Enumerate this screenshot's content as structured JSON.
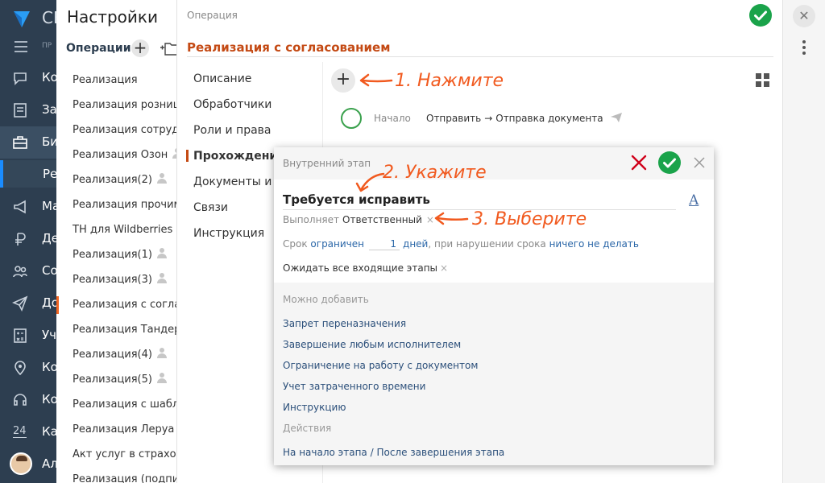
{
  "app": {
    "brand": "СБ",
    "menu_text": "ПР",
    "nav": [
      {
        "label": "Ко",
        "icon": "chat-icon"
      },
      {
        "label": "За",
        "icon": "tasks-icon"
      },
      {
        "label": "Би",
        "icon": "briefcase-icon"
      },
      {
        "label": "Ма",
        "icon": "megaphone-icon"
      },
      {
        "label": "Де",
        "icon": "money-icon"
      },
      {
        "label": "Со",
        "icon": "people-icon"
      },
      {
        "label": "До",
        "icon": "send-icon"
      },
      {
        "label": "Уч",
        "icon": "calculator-icon"
      },
      {
        "label": "Ко",
        "icon": "location-icon"
      },
      {
        "label": "Ко",
        "icon": "headset-icon"
      },
      {
        "label": "Ка",
        "icon": "calendar-icon"
      },
      {
        "label": "Ал",
        "icon": "avatar"
      }
    ],
    "nav_sub": "Ре",
    "calendar_day": "24"
  },
  "settings": {
    "title": "Настройки",
    "operations_label": "Операции",
    "operations": [
      {
        "label": "Реализация",
        "user": false
      },
      {
        "label": "Реализация розницы",
        "user": false
      },
      {
        "label": "Реализация сотрудникам",
        "user": false
      },
      {
        "label": "Реализация Озон",
        "user": true
      },
      {
        "label": "Реализация(2)",
        "user": true
      },
      {
        "label": "Реализация прочим покупателям",
        "user": false
      },
      {
        "label": "ТН для Wildberries",
        "user": false
      },
      {
        "label": "Реализация(1)",
        "user": true
      },
      {
        "label": "Реализация(3)",
        "user": true
      },
      {
        "label": "Реализация с согласованием",
        "user": false,
        "selected": true
      },
      {
        "label": "Реализация Тандер",
        "user": false
      },
      {
        "label": "Реализация(4)",
        "user": true
      },
      {
        "label": "Реализация(5)",
        "user": true
      },
      {
        "label": "Реализация с шаблоном",
        "user": false
      },
      {
        "label": "Реализация Леруа Мерлен",
        "user": false
      },
      {
        "label": "Акт услуг в страховую",
        "user": false
      },
      {
        "label": "Реализация (подписание)",
        "user": false
      }
    ]
  },
  "operation": {
    "kind": "Операция",
    "title": "Реализация с согласованием",
    "tabs": [
      "Описание",
      "Обработчики",
      "Роли и права",
      "Прохождение",
      "Документы и файлы",
      "Связи",
      "Инструкция"
    ],
    "active_tab": "Прохождение",
    "flow": {
      "start": "Начало",
      "action": "Отправить",
      "arrow": "→",
      "target": "Отправка документа"
    }
  },
  "stage": {
    "header": "Внутренний этап",
    "name": "Требуется исправить",
    "font_button": "A",
    "performer_label": "Выполняет",
    "performer_value": "Ответственный",
    "deadline_label": "Срок",
    "deadline_mode": "ограничен",
    "deadline_value": "1",
    "deadline_unit": "дней",
    "deadline_violation_text": ", при нарушении срока",
    "deadline_action": "ничего не делать",
    "wait_all": "Ожидать все входящие этапы",
    "can_add_label": "Можно добавить",
    "extras": [
      {
        "label": "Запрет переназначения",
        "muted": false
      },
      {
        "label": "Завершение любым исполнителем",
        "muted": false
      },
      {
        "label": "Ограничение на работу с документом",
        "muted": false
      },
      {
        "label": "Учет затраченного времени",
        "muted": false
      },
      {
        "label": "Инструкцию",
        "muted": false
      },
      {
        "label": "Действия",
        "muted": true
      }
    ],
    "footer_link": "На начало этапа / После завершения этапа"
  },
  "annotations": {
    "step1": "1. Нажмите",
    "step2": "2. Укажите",
    "step3": "3. Выберите"
  },
  "colors": {
    "accent": "#f15a1f",
    "title": "#c44a14",
    "link": "#2b67a8",
    "ok": "#1aa34a",
    "nav_bg": "#2d3e50"
  }
}
